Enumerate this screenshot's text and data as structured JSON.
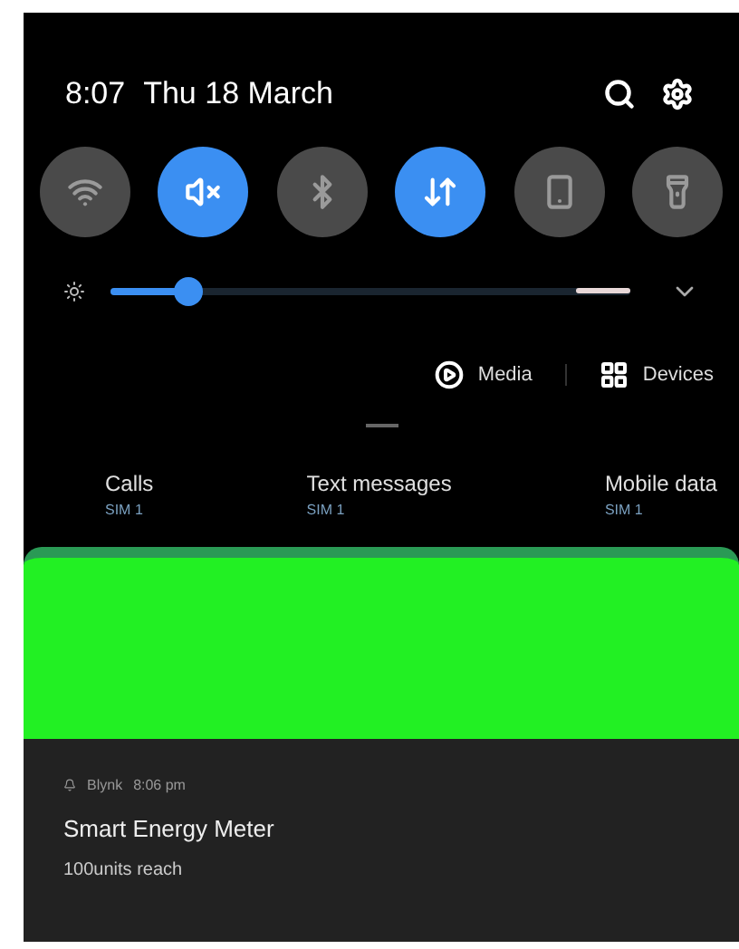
{
  "status": {
    "time": "8:07",
    "date": "Thu 18 March"
  },
  "toggles": [
    {
      "kind": "wifi",
      "on": false
    },
    {
      "kind": "mute",
      "on": true
    },
    {
      "kind": "bluetooth",
      "on": false
    },
    {
      "kind": "data",
      "on": true
    },
    {
      "kind": "rotation",
      "on": false
    },
    {
      "kind": "flashlight",
      "on": false
    }
  ],
  "brightness": {
    "level": 0.15
  },
  "output": [
    {
      "kind": "media",
      "label": "Media"
    },
    {
      "kind": "devices",
      "label": "Devices"
    }
  ],
  "sim_prefs": [
    {
      "label": "Calls",
      "sim": "SIM 1"
    },
    {
      "label": "Text messages",
      "sim": "SIM 1"
    },
    {
      "label": "Mobile data",
      "sim": "SIM 1"
    }
  ],
  "notification": {
    "app": "Blynk",
    "time": "8:06 pm",
    "title": "Smart Energy Meter",
    "body": "100units reach"
  }
}
